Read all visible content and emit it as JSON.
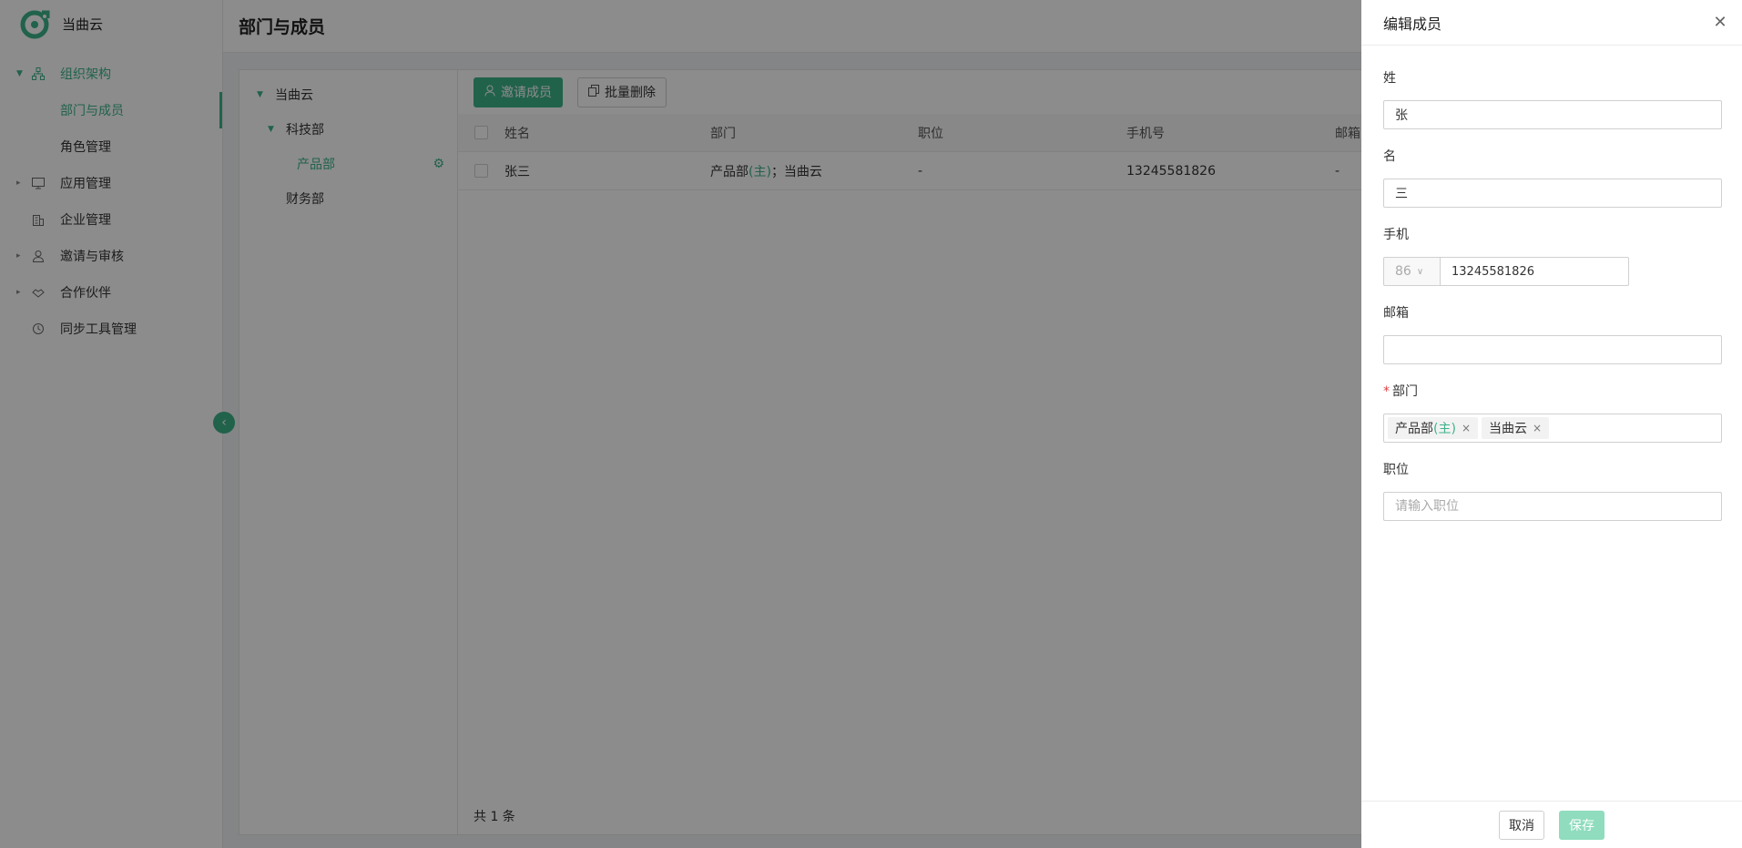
{
  "app": {
    "name": "当曲云"
  },
  "sidebar": {
    "items": [
      {
        "label": "组织架构",
        "icon": "org-chart-icon",
        "expanded": true
      },
      {
        "label": "部门与成员",
        "sub": true,
        "active": true
      },
      {
        "label": "角色管理",
        "sub": true
      },
      {
        "label": "应用管理",
        "icon": "monitor-icon"
      },
      {
        "label": "企业管理",
        "icon": "building-icon"
      },
      {
        "label": "邀请与审核",
        "icon": "user-check-icon"
      },
      {
        "label": "合作伙伴",
        "icon": "handshake-icon"
      },
      {
        "label": "同步工具管理",
        "icon": "sync-icon"
      }
    ]
  },
  "page": {
    "title": "部门与成员"
  },
  "tree": {
    "nodes": [
      {
        "label": "当曲云",
        "level": 0,
        "expanded": true
      },
      {
        "label": "科技部",
        "level": 1,
        "expanded": true
      },
      {
        "label": "产品部",
        "level": 2,
        "selected": true
      },
      {
        "label": "财务部",
        "level": 1
      }
    ]
  },
  "toolbar": {
    "invite_label": "邀请成员",
    "batch_delete_label": "批量删除"
  },
  "table": {
    "columns": [
      "姓名",
      "部门",
      "职位",
      "手机号",
      "邮箱"
    ],
    "rows": [
      {
        "name": "张三",
        "dept_main": "产品部",
        "dept_main_tag": "(主)",
        "dept_rest": "；当曲云",
        "position": "-",
        "phone": "13245581826",
        "email": "-"
      }
    ],
    "total_text": "共 1 条"
  },
  "drawer": {
    "title": "编辑成员",
    "last_name_label": "姓",
    "last_name_value": "张",
    "first_name_label": "名",
    "first_name_value": "三",
    "phone_label": "手机",
    "phone_code": "86",
    "phone_value": "13245581826",
    "email_label": "邮箱",
    "email_value": "",
    "dept_label": "部门",
    "dept_tags": [
      {
        "label": "产品部",
        "tag": "(主)"
      },
      {
        "label": "当曲云",
        "tag": ""
      }
    ],
    "position_label": "职位",
    "position_placeholder": "请输入职位",
    "cancel_label": "取消",
    "save_label": "保存"
  },
  "colors": {
    "accent": "#3db389",
    "save_disabled": "#8fdcbe",
    "required": "#e04040"
  }
}
